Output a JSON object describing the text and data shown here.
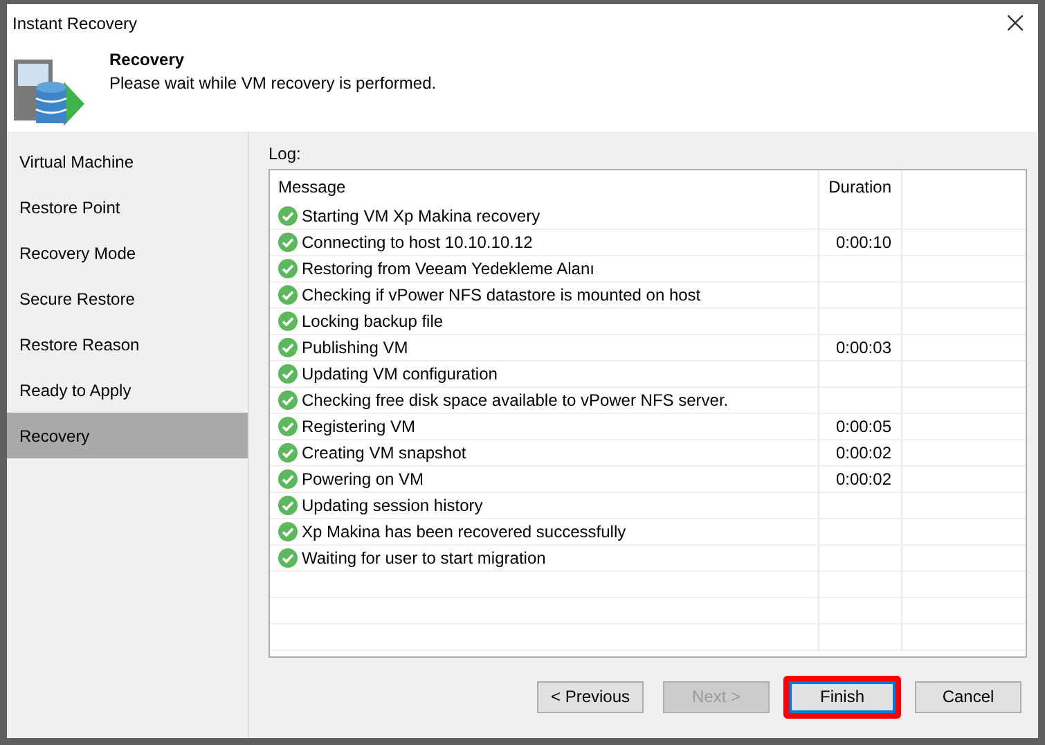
{
  "window": {
    "title": "Instant Recovery"
  },
  "header": {
    "title": "Recovery",
    "subtitle": "Please wait while VM recovery is performed."
  },
  "sidebar": {
    "items": [
      {
        "label": "Virtual Machine",
        "selected": false
      },
      {
        "label": "Restore Point",
        "selected": false
      },
      {
        "label": "Recovery Mode",
        "selected": false
      },
      {
        "label": "Secure Restore",
        "selected": false
      },
      {
        "label": "Restore Reason",
        "selected": false
      },
      {
        "label": "Ready to Apply",
        "selected": false
      },
      {
        "label": "Recovery",
        "selected": true
      }
    ]
  },
  "log": {
    "label": "Log:",
    "columns": [
      "Message",
      "Duration"
    ],
    "rows": [
      {
        "message": "Starting VM Xp Makina recovery",
        "succeeded": true
      },
      {
        "message": "Connecting to host 10.10.10.12",
        "duration": "0:00:10",
        "succeeded": true
      },
      {
        "message": "Restoring from Veeam Yedekleme Alanı",
        "succeeded": true
      },
      {
        "message": "Checking if vPower NFS datastore is mounted on host",
        "succeeded": true
      },
      {
        "message": "Locking backup file",
        "succeeded": true
      },
      {
        "message": "Publishing VM",
        "duration": "0:00:03",
        "succeeded": true
      },
      {
        "message": "Updating VM configuration",
        "succeeded": true
      },
      {
        "message": "Checking free disk space available to vPower NFS server.",
        "succeeded": true
      },
      {
        "message": "Registering VM",
        "duration": "0:00:05",
        "succeeded": true
      },
      {
        "message": "Creating VM snapshot",
        "duration": "0:00:02",
        "succeeded": true
      },
      {
        "message": "Powering on VM",
        "duration": "0:00:02",
        "succeeded": true
      },
      {
        "message": "Updating session history",
        "succeeded": true
      },
      {
        "message": "Xp Makina has been recovered successfully",
        "succeeded": true
      },
      {
        "message": "Waiting for user to start migration",
        "succeeded": true
      }
    ]
  },
  "buttons": [
    {
      "label": "< Previous",
      "disabled": false,
      "default": false,
      "highlighted": false
    },
    {
      "label": "Next >",
      "disabled": true,
      "default": false,
      "highlighted": false
    },
    {
      "label": "Finish",
      "disabled": false,
      "default": true,
      "highlighted": true
    },
    {
      "label": "Cancel",
      "disabled": false,
      "default": false,
      "highlighted": false
    }
  ]
}
